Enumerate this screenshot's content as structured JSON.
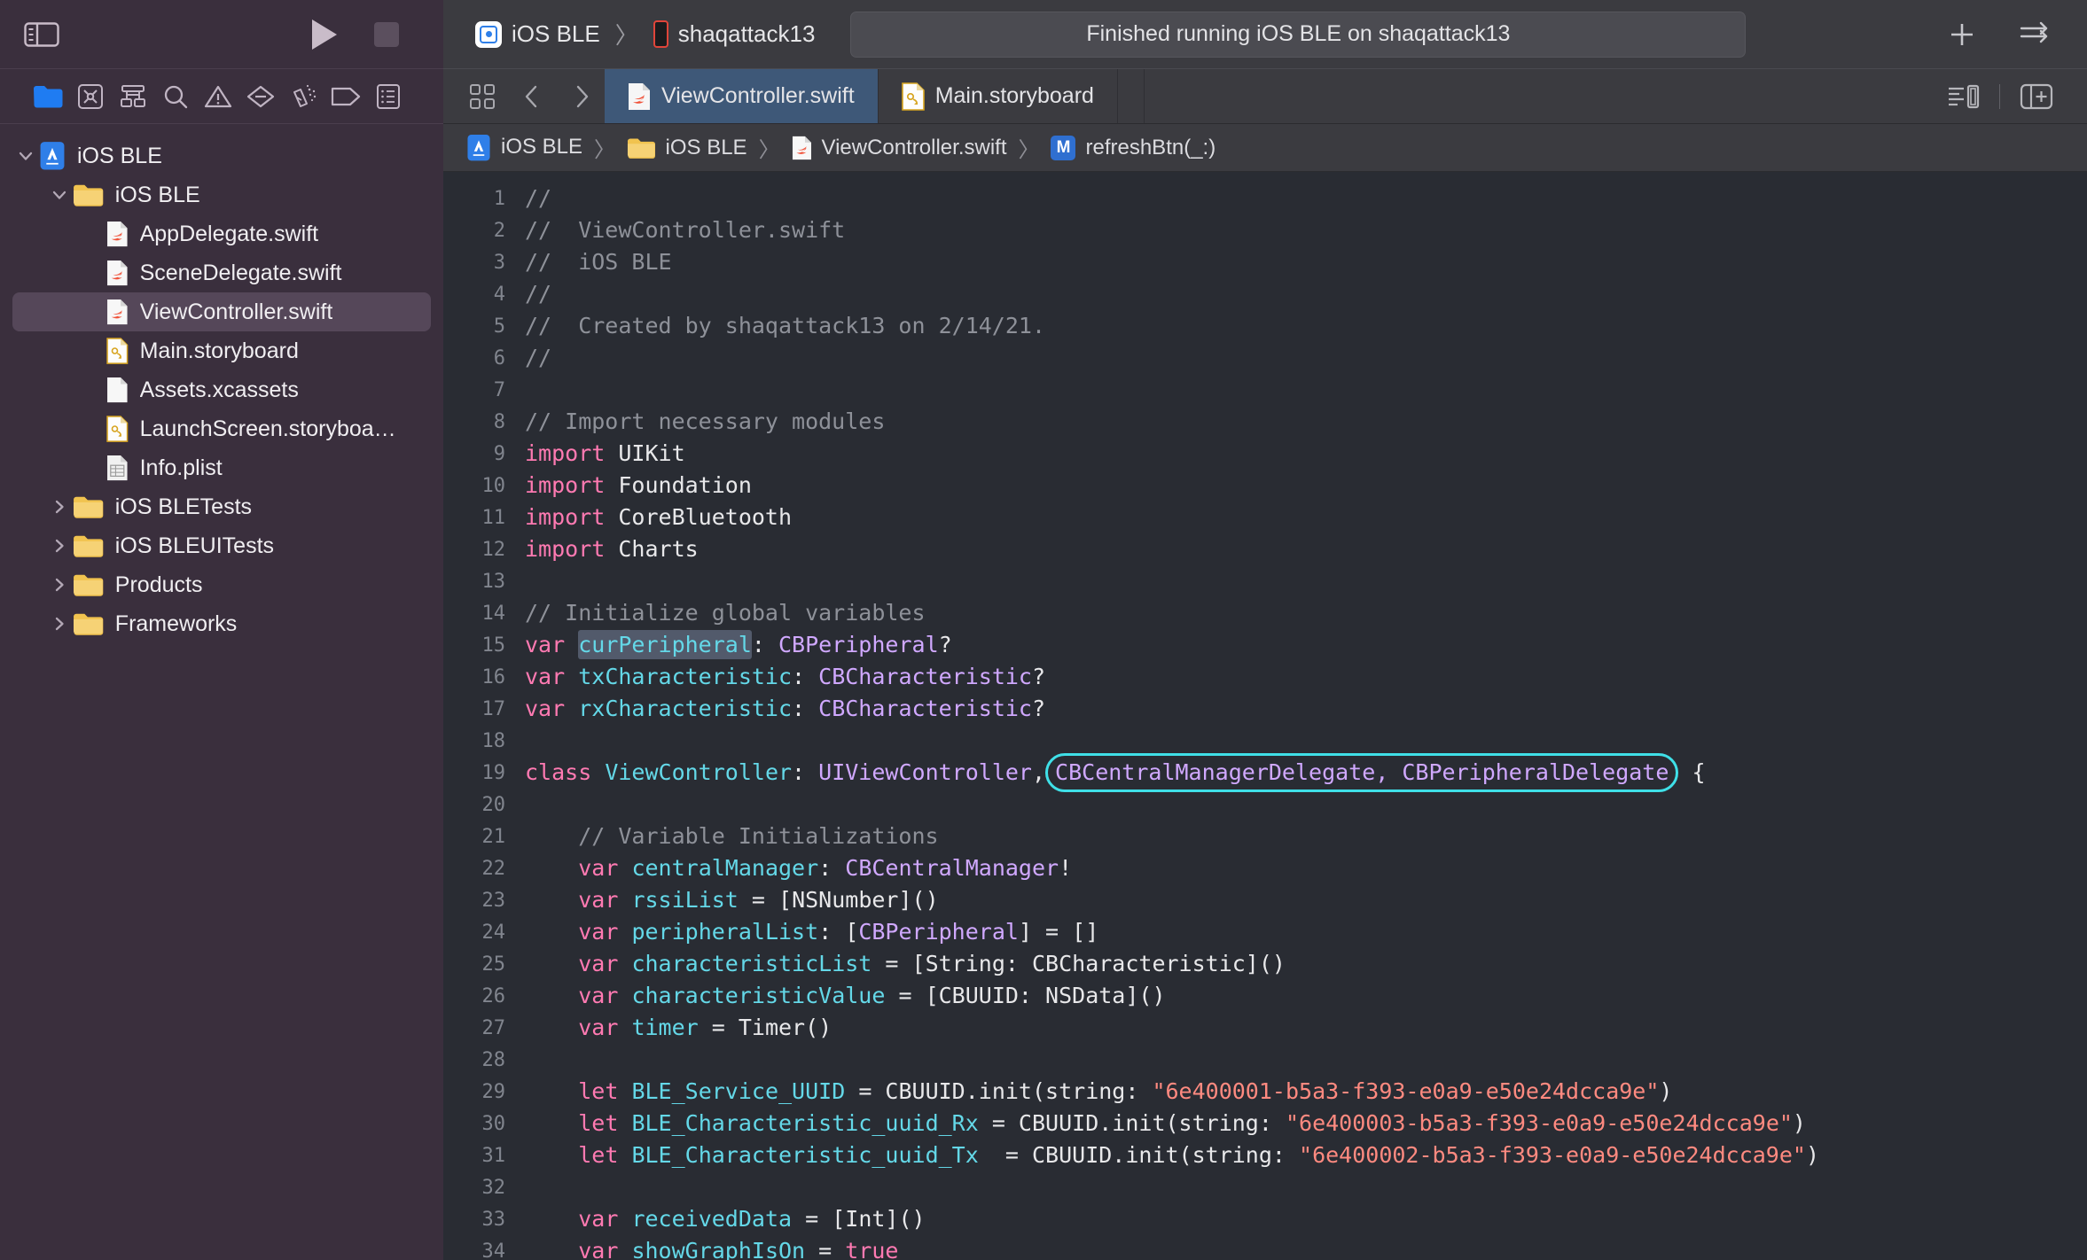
{
  "toolbar": {
    "sidebar_toggle_icon": "sidebar-toggle-icon",
    "run_icon": "play-icon",
    "stop_icon": "stop-icon",
    "scheme_name": "iOS BLE",
    "destination_name": "shaqattack13",
    "scheme_separator": "〉",
    "status_text": "Finished running iOS BLE on shaqattack13",
    "add_icon": "plus-icon",
    "assistant_icon": "swap-arrows-icon"
  },
  "navigator_filters": [
    {
      "name": "folder-icon",
      "label": "Project navigator",
      "active": true
    },
    {
      "name": "source-control-icon",
      "label": "Source control navigator",
      "active": false
    },
    {
      "name": "hierarchy-icon",
      "label": "Symbol navigator",
      "active": false
    },
    {
      "name": "search-icon",
      "label": "Find navigator",
      "active": false
    },
    {
      "name": "warning-triangle-icon",
      "label": "Issue navigator",
      "active": false
    },
    {
      "name": "test-diamond-icon",
      "label": "Test navigator",
      "active": false
    },
    {
      "name": "spray-can-icon",
      "label": "Debug navigator",
      "active": false
    },
    {
      "name": "tag-icon",
      "label": "Breakpoint navigator",
      "active": false
    },
    {
      "name": "report-list-icon",
      "label": "Report navigator",
      "active": false
    }
  ],
  "navigator": {
    "items": [
      {
        "label": "iOS BLE",
        "icon": "xcode-project-icon",
        "depth": 0,
        "twisty": "down",
        "selected": false
      },
      {
        "label": "iOS BLE",
        "icon": "folder-icon",
        "depth": 1,
        "twisty": "down",
        "selected": false
      },
      {
        "label": "AppDelegate.swift",
        "icon": "swift-file-icon",
        "depth": 2,
        "twisty": "none",
        "selected": false
      },
      {
        "label": "SceneDelegate.swift",
        "icon": "swift-file-icon",
        "depth": 2,
        "twisty": "none",
        "selected": false
      },
      {
        "label": "ViewController.swift",
        "icon": "swift-file-icon",
        "depth": 2,
        "twisty": "none",
        "selected": true
      },
      {
        "label": "Main.storyboard",
        "icon": "storyboard-file-icon",
        "depth": 2,
        "twisty": "none",
        "selected": false
      },
      {
        "label": "Assets.xcassets",
        "icon": "blank-file-icon",
        "depth": 2,
        "twisty": "none",
        "selected": false
      },
      {
        "label": "LaunchScreen.storyboa…",
        "icon": "storyboard-file-icon",
        "depth": 2,
        "twisty": "none",
        "selected": false
      },
      {
        "label": "Info.plist",
        "icon": "plist-file-icon",
        "depth": 2,
        "twisty": "none",
        "selected": false
      },
      {
        "label": "iOS BLETests",
        "icon": "folder-icon",
        "depth": 1,
        "twisty": "right",
        "selected": false
      },
      {
        "label": "iOS BLEUITests",
        "icon": "folder-icon",
        "depth": 1,
        "twisty": "right",
        "selected": false
      },
      {
        "label": "Products",
        "icon": "folder-icon",
        "depth": 1,
        "twisty": "right",
        "selected": false
      },
      {
        "label": "Frameworks",
        "icon": "folder-icon",
        "depth": 1,
        "twisty": "right",
        "selected": false
      }
    ]
  },
  "tabbar": {
    "grid_icon": "editor-options-icon",
    "back_icon": "chevron-left-icon",
    "forward_icon": "chevron-right-icon",
    "tabs": [
      {
        "label": "ViewController.swift",
        "icon": "swift-file-icon",
        "active": true
      },
      {
        "label": "Main.storyboard",
        "icon": "storyboard-file-icon",
        "active": false
      }
    ],
    "minimap_icon": "minimap-icon",
    "add_editor_icon": "add-editor-icon"
  },
  "breadcrumb": {
    "items": [
      {
        "label": "iOS BLE",
        "icon": "xcode-project-icon"
      },
      {
        "label": "iOS BLE",
        "icon": "folder-icon"
      },
      {
        "label": "ViewController.swift",
        "icon": "swift-file-icon"
      },
      {
        "label": "refreshBtn(_:)",
        "icon": "method-badge-icon"
      }
    ],
    "separator": "〉"
  },
  "code": {
    "language": "swift",
    "first_line": 1,
    "selected_token": "curPeripheral",
    "annotation": {
      "text": "CBCentralManagerDelegate, CBPeripheralDelegate",
      "line": 19,
      "color": "#3fe0e8",
      "shape": "rounded-rectangle-outline"
    },
    "lines": [
      {
        "n": 1,
        "tokens": [
          {
            "c": "cm",
            "s": "//"
          }
        ]
      },
      {
        "n": 2,
        "tokens": [
          {
            "c": "cm",
            "s": "//  ViewController.swift"
          }
        ]
      },
      {
        "n": 3,
        "tokens": [
          {
            "c": "cm",
            "s": "//  iOS BLE"
          }
        ]
      },
      {
        "n": 4,
        "tokens": [
          {
            "c": "cm",
            "s": "//"
          }
        ]
      },
      {
        "n": 5,
        "tokens": [
          {
            "c": "cm",
            "s": "//  Created by shaqattack13 on 2/14/21."
          }
        ]
      },
      {
        "n": 6,
        "tokens": [
          {
            "c": "cm",
            "s": "//"
          }
        ]
      },
      {
        "n": 7,
        "tokens": []
      },
      {
        "n": 8,
        "tokens": [
          {
            "c": "cm",
            "s": "// Import necessary modules"
          }
        ]
      },
      {
        "n": 9,
        "tokens": [
          {
            "c": "k",
            "s": "import"
          },
          {
            "c": "p",
            "s": " UIKit"
          }
        ]
      },
      {
        "n": 10,
        "tokens": [
          {
            "c": "k",
            "s": "import"
          },
          {
            "c": "p",
            "s": " Foundation"
          }
        ]
      },
      {
        "n": 11,
        "tokens": [
          {
            "c": "k",
            "s": "import"
          },
          {
            "c": "p",
            "s": " CoreBluetooth"
          }
        ]
      },
      {
        "n": 12,
        "tokens": [
          {
            "c": "k",
            "s": "import"
          },
          {
            "c": "p",
            "s": " Charts"
          }
        ]
      },
      {
        "n": 13,
        "tokens": []
      },
      {
        "n": 14,
        "tokens": [
          {
            "c": "cm",
            "s": "// Initialize global variables"
          }
        ]
      },
      {
        "n": 15,
        "tokens": [
          {
            "c": "k",
            "s": "var"
          },
          {
            "c": "p",
            "s": " "
          },
          {
            "c": "v sel",
            "s": "curPeripheral"
          },
          {
            "c": "p",
            "s": ": "
          },
          {
            "c": "t",
            "s": "CBPeripheral"
          },
          {
            "c": "p",
            "s": "?"
          }
        ]
      },
      {
        "n": 16,
        "tokens": [
          {
            "c": "k",
            "s": "var"
          },
          {
            "c": "p",
            "s": " "
          },
          {
            "c": "v",
            "s": "txCharacteristic"
          },
          {
            "c": "p",
            "s": ": "
          },
          {
            "c": "t",
            "s": "CBCharacteristic"
          },
          {
            "c": "p",
            "s": "?"
          }
        ]
      },
      {
        "n": 17,
        "tokens": [
          {
            "c": "k",
            "s": "var"
          },
          {
            "c": "p",
            "s": " "
          },
          {
            "c": "v",
            "s": "rxCharacteristic"
          },
          {
            "c": "p",
            "s": ": "
          },
          {
            "c": "t",
            "s": "CBCharacteristic"
          },
          {
            "c": "p",
            "s": "?"
          }
        ]
      },
      {
        "n": 18,
        "tokens": []
      },
      {
        "n": 19,
        "tokens": [
          {
            "c": "k",
            "s": "class"
          },
          {
            "c": "p",
            "s": " "
          },
          {
            "c": "v",
            "s": "ViewController"
          },
          {
            "c": "p",
            "s": ": "
          },
          {
            "c": "t",
            "s": "UIViewController"
          },
          {
            "c": "p",
            "s": ","
          },
          {
            "c": "annot",
            "s": "CBCentralManagerDelegate, CBPeripheralDelegate"
          },
          {
            "c": "p",
            "s": " {"
          }
        ]
      },
      {
        "n": 20,
        "tokens": []
      },
      {
        "n": 21,
        "tokens": [
          {
            "c": "cm",
            "s": "    // Variable Initializations"
          }
        ]
      },
      {
        "n": 22,
        "tokens": [
          {
            "c": "p",
            "s": "    "
          },
          {
            "c": "k",
            "s": "var"
          },
          {
            "c": "p",
            "s": " "
          },
          {
            "c": "v",
            "s": "centralManager"
          },
          {
            "c": "p",
            "s": ": "
          },
          {
            "c": "t",
            "s": "CBCentralManager"
          },
          {
            "c": "p",
            "s": "!"
          }
        ]
      },
      {
        "n": 23,
        "tokens": [
          {
            "c": "p",
            "s": "    "
          },
          {
            "c": "k",
            "s": "var"
          },
          {
            "c": "p",
            "s": " "
          },
          {
            "c": "v",
            "s": "rssiList"
          },
          {
            "c": "p",
            "s": " = [NSNumber]()"
          }
        ]
      },
      {
        "n": 24,
        "tokens": [
          {
            "c": "p",
            "s": "    "
          },
          {
            "c": "k",
            "s": "var"
          },
          {
            "c": "p",
            "s": " "
          },
          {
            "c": "v",
            "s": "peripheralList"
          },
          {
            "c": "p",
            "s": ": ["
          },
          {
            "c": "t",
            "s": "CBPeripheral"
          },
          {
            "c": "p",
            "s": "] = []"
          }
        ]
      },
      {
        "n": 25,
        "tokens": [
          {
            "c": "p",
            "s": "    "
          },
          {
            "c": "k",
            "s": "var"
          },
          {
            "c": "p",
            "s": " "
          },
          {
            "c": "v",
            "s": "characteristicList"
          },
          {
            "c": "p",
            "s": " = [String: CBCharacteristic]()"
          }
        ]
      },
      {
        "n": 26,
        "tokens": [
          {
            "c": "p",
            "s": "    "
          },
          {
            "c": "k",
            "s": "var"
          },
          {
            "c": "p",
            "s": " "
          },
          {
            "c": "v",
            "s": "characteristicValue"
          },
          {
            "c": "p",
            "s": " = [CBUUID: NSData]()"
          }
        ]
      },
      {
        "n": 27,
        "tokens": [
          {
            "c": "p",
            "s": "    "
          },
          {
            "c": "k",
            "s": "var"
          },
          {
            "c": "p",
            "s": " "
          },
          {
            "c": "v",
            "s": "timer"
          },
          {
            "c": "p",
            "s": " = Timer()"
          }
        ]
      },
      {
        "n": 28,
        "tokens": []
      },
      {
        "n": 29,
        "tokens": [
          {
            "c": "p",
            "s": "    "
          },
          {
            "c": "k",
            "s": "let"
          },
          {
            "c": "p",
            "s": " "
          },
          {
            "c": "v",
            "s": "BLE_Service_UUID"
          },
          {
            "c": "p",
            "s": " = CBUUID.init(string: "
          },
          {
            "c": "s",
            "s": "\"6e400001-b5a3-f393-e0a9-e50e24dcca9e\""
          },
          {
            "c": "p",
            "s": ")"
          }
        ]
      },
      {
        "n": 30,
        "tokens": [
          {
            "c": "p",
            "s": "    "
          },
          {
            "c": "k",
            "s": "let"
          },
          {
            "c": "p",
            "s": " "
          },
          {
            "c": "v",
            "s": "BLE_Characteristic_uuid_Rx"
          },
          {
            "c": "p",
            "s": " = CBUUID.init(string: "
          },
          {
            "c": "s",
            "s": "\"6e400003-b5a3-f393-e0a9-e50e24dcca9e\""
          },
          {
            "c": "p",
            "s": ")"
          }
        ]
      },
      {
        "n": 31,
        "tokens": [
          {
            "c": "p",
            "s": "    "
          },
          {
            "c": "k",
            "s": "let"
          },
          {
            "c": "p",
            "s": " "
          },
          {
            "c": "v",
            "s": "BLE_Characteristic_uuid_Tx"
          },
          {
            "c": "p",
            "s": "  = CBUUID.init(string: "
          },
          {
            "c": "s",
            "s": "\"6e400002-b5a3-f393-e0a9-e50e24dcca9e\""
          },
          {
            "c": "p",
            "s": ")"
          }
        ]
      },
      {
        "n": 32,
        "tokens": []
      },
      {
        "n": 33,
        "tokens": [
          {
            "c": "p",
            "s": "    "
          },
          {
            "c": "k",
            "s": "var"
          },
          {
            "c": "p",
            "s": " "
          },
          {
            "c": "v",
            "s": "receivedData"
          },
          {
            "c": "p",
            "s": " = [Int]()"
          }
        ]
      },
      {
        "n": 34,
        "tokens": [
          {
            "c": "p",
            "s": "    "
          },
          {
            "c": "k",
            "s": "var"
          },
          {
            "c": "p",
            "s": " "
          },
          {
            "c": "v",
            "s": "showGraphIsOn"
          },
          {
            "c": "p",
            "s": " = "
          },
          {
            "c": "k",
            "s": "true"
          }
        ]
      }
    ]
  },
  "colors": {
    "sidebar_bg": "#3a2f3d",
    "toolbar_bg": "#3b3b40",
    "editor_bg": "#292c33",
    "tab_active_bg": "#3e5878",
    "keyword": "#ff7ab2",
    "comment": "#8e9199",
    "string": "#ff8a80",
    "type": "#d0a8ff",
    "variable": "#64d8e8",
    "annotation": "#3fe0e8",
    "accent_blue": "#2f7fe8"
  }
}
